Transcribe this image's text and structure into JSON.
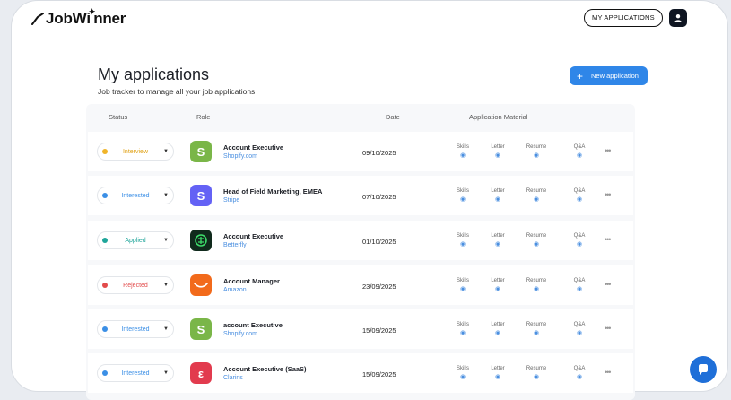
{
  "brand": {
    "name_part1": "JobWi",
    "name_part2": "nner"
  },
  "header": {
    "my_applications_label": "MY APPLICATIONS"
  },
  "page": {
    "title": "My applications",
    "subtitle": "Job tracker to manage all your job applications",
    "new_button_label": "New application"
  },
  "table": {
    "headers": {
      "status": "Status",
      "role": "Role",
      "date": "Date",
      "material": "Application Material"
    },
    "material_labels": [
      "Skills",
      "Letter",
      "Resume",
      "Q&A"
    ],
    "rows": [
      {
        "status": "Interview",
        "status_color": "#f0b429",
        "status_text_color": "#e0a217",
        "logo": "shopify-logo",
        "logo_color": "#7ab648",
        "logo_glyph": "S",
        "title": "Account Executive",
        "company": "Shopify.com",
        "date": "09/10/2025"
      },
      {
        "status": "Interested",
        "status_color": "#3b8fe6",
        "status_text_color": "#3b8fe6",
        "logo": "stripe-logo",
        "logo_color": "#6462f5",
        "logo_glyph": "S",
        "title": "Head of Field Marketing, EMEA",
        "company": "Stripe",
        "date": "07/10/2025"
      },
      {
        "status": "Applied",
        "status_color": "#1fa59a",
        "status_text_color": "#1fa59a",
        "logo": "betterfly-logo",
        "logo_color": "#102a1c",
        "logo_glyph": "",
        "title": "Account Executive",
        "company": "Betterfly",
        "date": "01/10/2025"
      },
      {
        "status": "Rejected",
        "status_color": "#e24b4b",
        "status_text_color": "#e24b4b",
        "logo": "amazon-logo",
        "logo_color": "#f26a1b",
        "logo_glyph": "",
        "title": "Account Manager",
        "company": "Amazon",
        "date": "23/09/2025"
      },
      {
        "status": "Interested",
        "status_color": "#3b8fe6",
        "status_text_color": "#3b8fe6",
        "logo": "shopify-logo",
        "logo_color": "#7ab648",
        "logo_glyph": "S",
        "title": "account Executive",
        "company": "Shopify.com",
        "date": "15/09/2025"
      },
      {
        "status": "Interested",
        "status_color": "#3b8fe6",
        "status_text_color": "#3b8fe6",
        "logo": "clarivate-logo",
        "logo_color": "#e23b4e",
        "logo_glyph": "ε",
        "title": "Account Executive (SaaS)",
        "company": "Clarins",
        "date": "15/09/2025"
      }
    ]
  },
  "colors": {
    "accent": "#2f86e8",
    "dark": "#0f1622",
    "link": "#4a8fe0"
  },
  "icons": {
    "user": "user-icon",
    "plus": "plus-icon",
    "eye": "eye-icon",
    "more": "more-icon",
    "chat": "chat-icon"
  }
}
